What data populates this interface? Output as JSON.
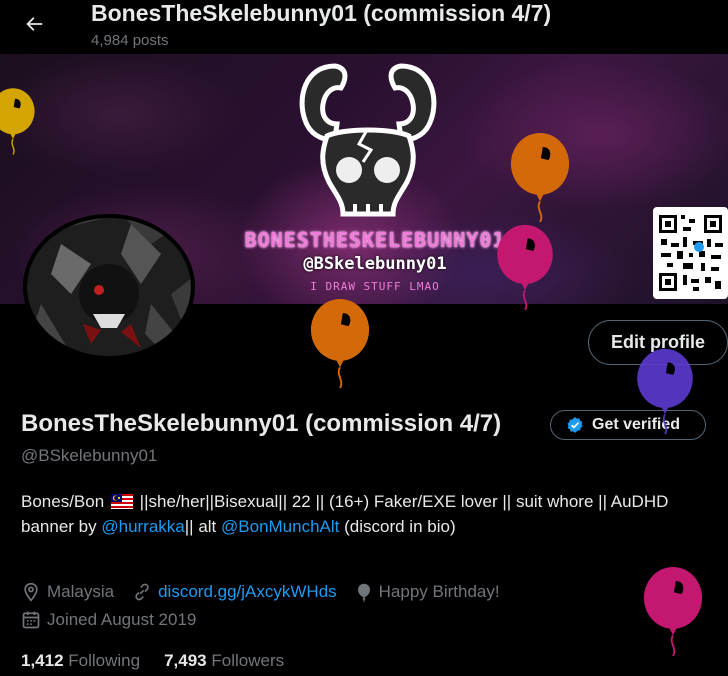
{
  "header": {
    "display_name": "BonesTheSkelebunny01 (commission 4/7)",
    "post_count": "4,984 posts"
  },
  "banner": {
    "line1": "BONESTHESKELEBUNNY01",
    "line2": "@BSkelebunny01",
    "line3": "I DRAW STUFF LMAO"
  },
  "profile": {
    "edit_label": "Edit profile",
    "name": "BonesTheSkelebunny01 (commission 4/7)",
    "verify_label": "Get verified",
    "handle": "@BSkelebunny01"
  },
  "bio": {
    "part1": "Bones/Bon",
    "part2": "||she/her||Bisexual|| 22 || (16+) Faker/EXE lover || suit whore || AuDHD",
    "part3": "banner by",
    "link1": "@hurrakka",
    "part4": "|| alt",
    "link2": "@BonMunchAlt",
    "part5": "(discord in bio)"
  },
  "meta": {
    "location": "Malaysia",
    "website": "discord.gg/jAxcykWHds",
    "birthday": "Happy Birthday!",
    "joined": "Joined August 2019"
  },
  "stats": {
    "following_count": "1,412",
    "following_label": "Following",
    "followers_count": "7,493",
    "followers_label": "Followers"
  },
  "colors": {
    "accent": "#1d9bf0",
    "balloon_yellow": "#d4a500",
    "balloon_orange": "#d4690a",
    "balloon_pink": "#c4176f",
    "balloon_purple": "#5b3bd1"
  }
}
